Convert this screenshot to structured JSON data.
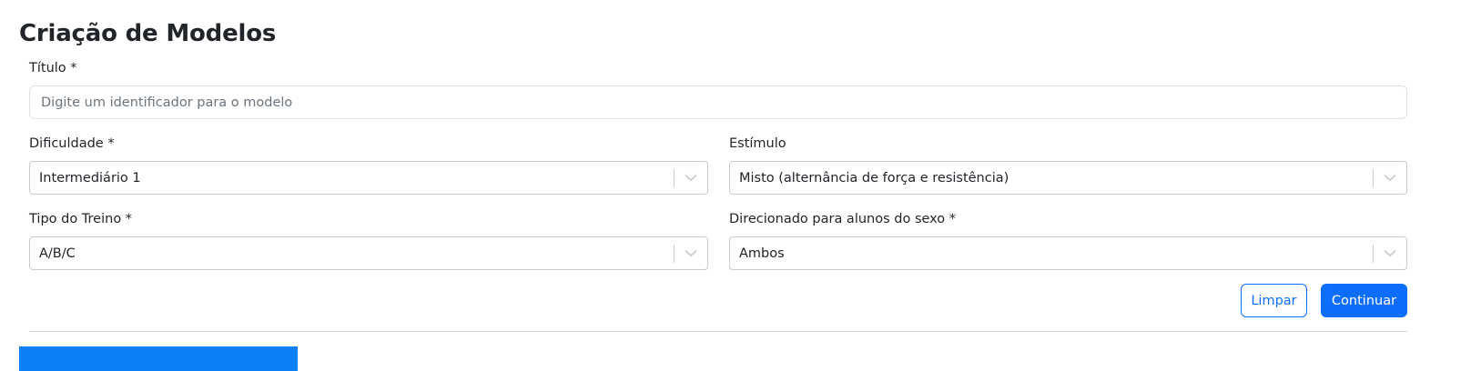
{
  "page": {
    "title": "Criação de Modelos"
  },
  "form": {
    "titulo": {
      "label": "Título *",
      "value": "",
      "placeholder": "Digite um identificador para o modelo"
    },
    "dificuldade": {
      "label": "Dificuldade *",
      "value": "Intermediário 1"
    },
    "estimulo": {
      "label": "Estímulo",
      "value": "Misto (alternância de força e resistência)"
    },
    "tipo_treino": {
      "label": "Tipo do Treino *",
      "value": "A/B/C"
    },
    "sexo": {
      "label": "Direcionado para alunos do sexo *",
      "value": "Ambos"
    }
  },
  "actions": {
    "clear_label": "Limpar",
    "continue_label": "Continuar"
  },
  "colors": {
    "primary": "#0d6efd",
    "text": "#212529",
    "border": "#cccccc"
  },
  "icons": {
    "select_indicator": "chevron-down-icon"
  }
}
